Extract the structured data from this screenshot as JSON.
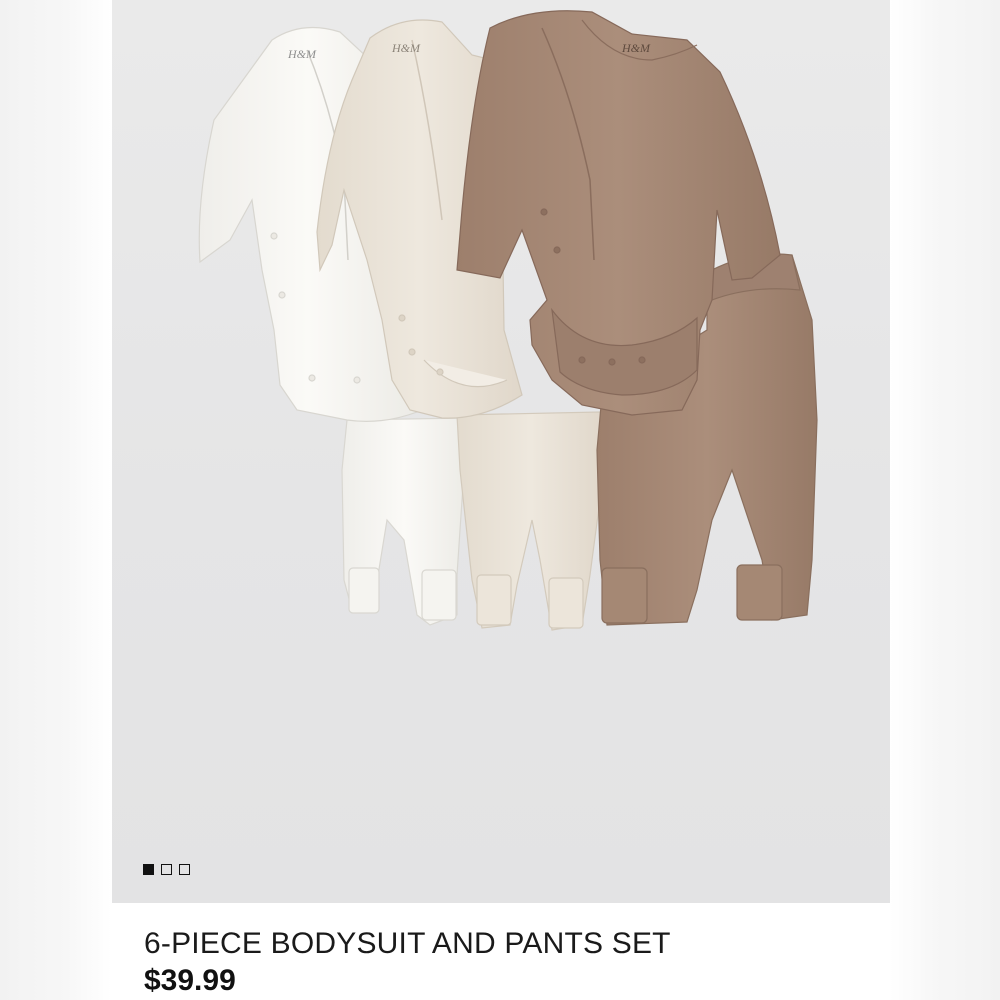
{
  "product": {
    "title": "6-PIECE BODYSUIT AND PANTS SET",
    "price": "$39.99",
    "image_alt": "three bodysuits and three pants in white, cream and taupe"
  },
  "carousel": {
    "total": 3,
    "active_index": 0
  },
  "colors": {
    "white_garment": "#f7f6f2",
    "cream_garment": "#ebe4d9",
    "taupe_garment": "#a78a77",
    "background": "#e6e6e7"
  }
}
